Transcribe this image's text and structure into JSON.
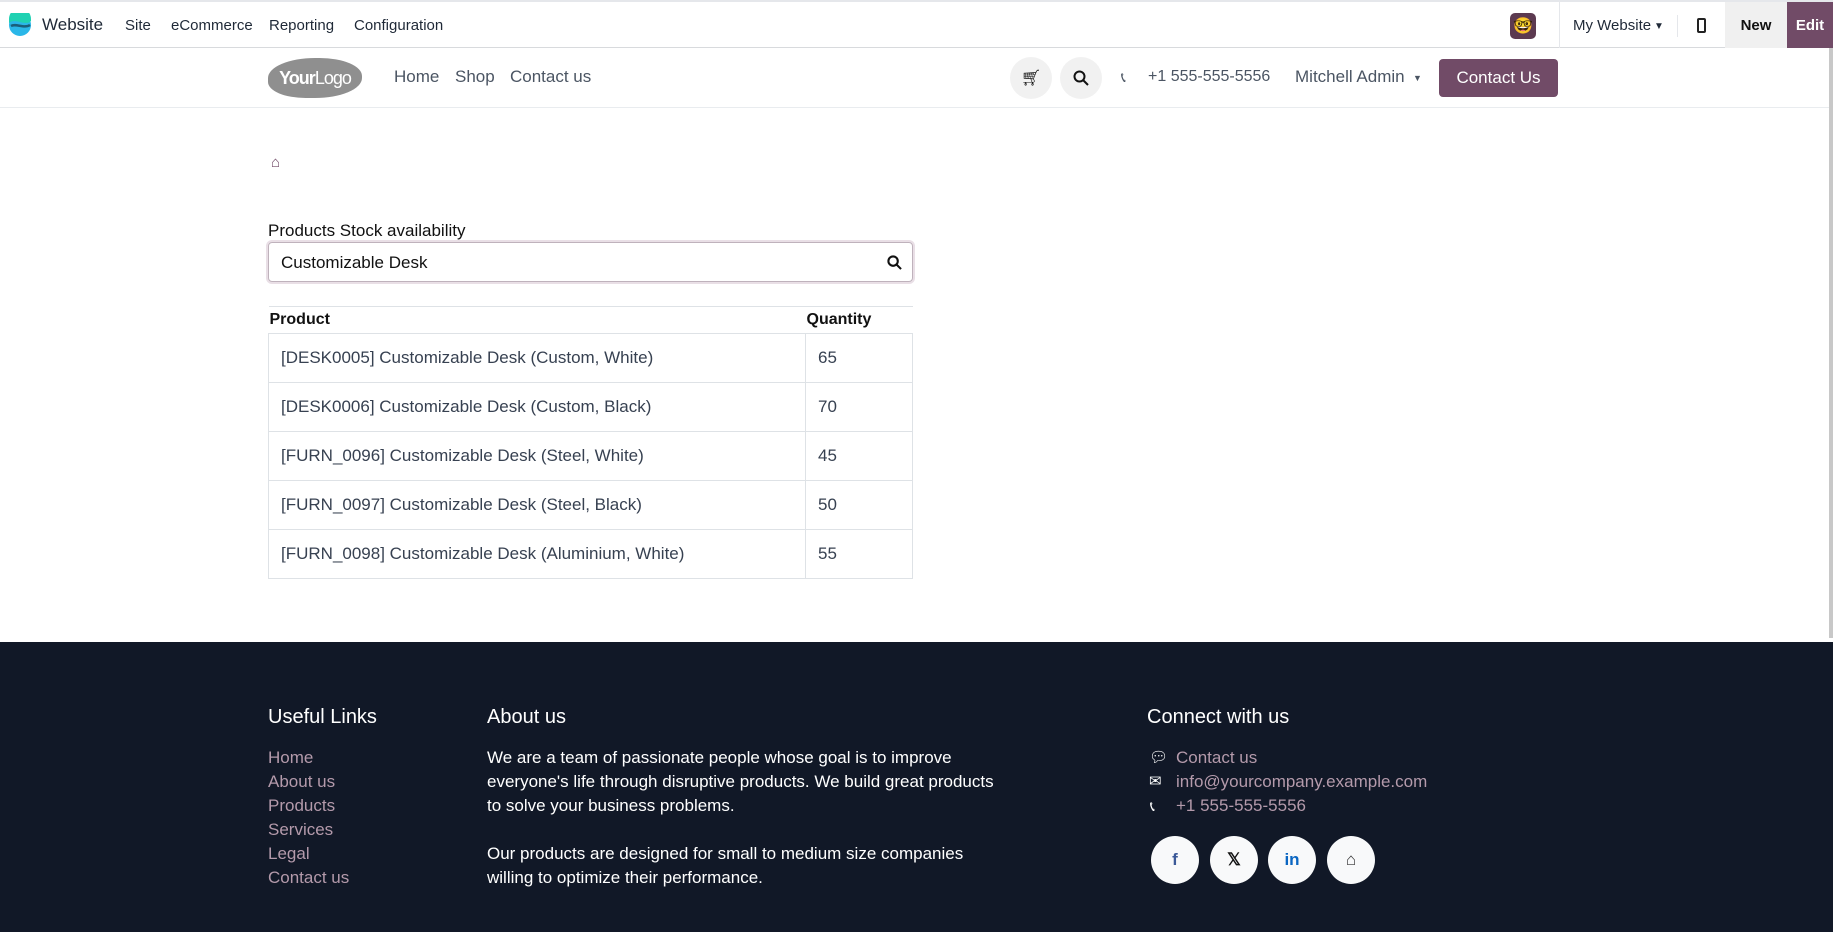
{
  "topbar": {
    "app": "Website",
    "menus": [
      "Site",
      "eCommerce",
      "Reporting",
      "Configuration"
    ],
    "website_selector": "My Website",
    "new_label": "New",
    "edit_label": "Edit"
  },
  "header": {
    "logo": "YourLogo",
    "nav": [
      "Home",
      "Shop",
      "Contact us"
    ],
    "phone": "+1 555-555-5556",
    "user": "Mitchell Admin",
    "cta": "Contact Us"
  },
  "main": {
    "label": "Products Stock availability",
    "search_value": "Customizable Desk",
    "columns": [
      "Product",
      "Quantity"
    ],
    "rows": [
      {
        "product": "[DESK0005] Customizable Desk (Custom, White)",
        "qty": "65"
      },
      {
        "product": "[DESK0006] Customizable Desk (Custom, Black)",
        "qty": "70"
      },
      {
        "product": "[FURN_0096] Customizable Desk (Steel, White)",
        "qty": "45"
      },
      {
        "product": "[FURN_0097] Customizable Desk (Steel, Black)",
        "qty": "50"
      },
      {
        "product": "[FURN_0098] Customizable Desk (Aluminium, White)",
        "qty": "55"
      }
    ]
  },
  "footer": {
    "useful_title": "Useful Links",
    "links": [
      "Home",
      "About us",
      "Products",
      "Services",
      "Legal",
      "Contact us"
    ],
    "about_title": "About us",
    "about_lines": [
      "We are a team of passionate people whose goal is to improve",
      "everyone's life through disruptive products. We build great products",
      "to solve your business problems.",
      "Our products are designed for small to medium size companies",
      "willing to optimize their performance."
    ],
    "connect_title": "Connect with us",
    "contact": "Contact us",
    "email": "info@yourcompany.example.com",
    "phone": "+1 555-555-5556",
    "social": [
      "facebook-icon",
      "x-icon",
      "linkedin-icon",
      "home-icon"
    ]
  },
  "colors": {
    "brand": "#714b67",
    "footer_bg": "#111827",
    "footer_link": "#b49aab"
  }
}
